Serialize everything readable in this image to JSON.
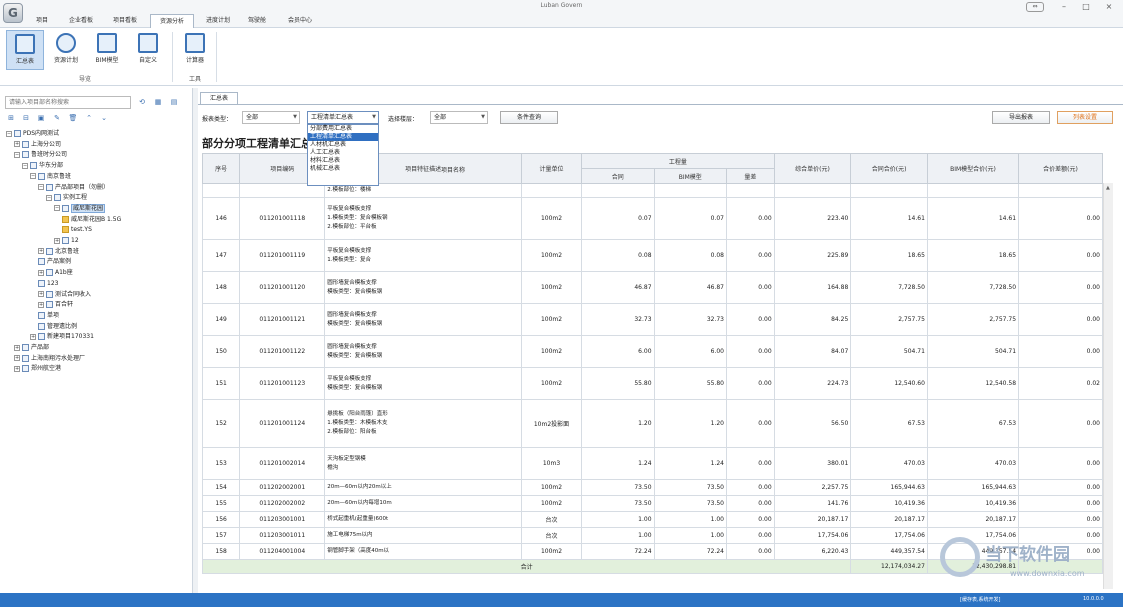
{
  "app": {
    "title": "Luban Govern"
  },
  "window": {
    "link_icon": "link-icon",
    "minimize": "–",
    "maximize": "□",
    "close": "×"
  },
  "menu": {
    "tabs": [
      {
        "label": "项目"
      },
      {
        "label": "企业看板"
      },
      {
        "label": "项目看板"
      },
      {
        "label": "资源分析"
      },
      {
        "label": "进度计划"
      },
      {
        "label": "驾驶舱"
      },
      {
        "label": "会员中心"
      }
    ],
    "active_index": 3
  },
  "ribbon": {
    "buttons": [
      {
        "label": "汇总表",
        "icon": "summary-table-icon"
      },
      {
        "label": "资源计划",
        "icon": "resource-plan-icon"
      },
      {
        "label": "BIM模型",
        "icon": "bim-model-icon"
      },
      {
        "label": "自定义",
        "icon": "custom-icon"
      },
      {
        "label": "计算器",
        "icon": "calculator-icon"
      }
    ],
    "group_nav": "导览",
    "group_tools": "工具"
  },
  "left": {
    "search_placeholder": "请输入项目部名称搜索",
    "tree": [
      {
        "label": "PDS内网测试",
        "level": 0,
        "exp": "−"
      },
      {
        "label": "上海分公司",
        "level": 1,
        "exp": "+"
      },
      {
        "label": "鲁班时分公司",
        "level": 1,
        "exp": "−"
      },
      {
        "label": "华东分部",
        "level": 2,
        "exp": "−"
      },
      {
        "label": "南京鲁班",
        "level": 3,
        "exp": "−"
      },
      {
        "label": "产品部项目（勿删）",
        "level": 4,
        "exp": "−"
      },
      {
        "label": "实例工程",
        "level": 5,
        "exp": "−"
      },
      {
        "label": "威尼斯花园",
        "level": 6,
        "exp": "−",
        "selected": true
      },
      {
        "label": "威尼斯花园B 1.5G",
        "level": 7,
        "folder": true
      },
      {
        "label": "test.YS",
        "level": 7,
        "folder": true
      },
      {
        "label": "12",
        "level": 6,
        "exp": "+"
      },
      {
        "label": "北京鲁班",
        "level": 4,
        "exp": "+"
      },
      {
        "label": "产品案例",
        "level": 4
      },
      {
        "label": "A1b座",
        "level": 4,
        "exp": "+"
      },
      {
        "label": "123",
        "level": 4
      },
      {
        "label": "测试合同收入",
        "level": 4,
        "exp": "+"
      },
      {
        "label": "百合轩",
        "level": 4,
        "exp": "+"
      },
      {
        "label": "单项",
        "level": 4
      },
      {
        "label": "管理遗比例",
        "level": 4
      },
      {
        "label": "新建项目170331",
        "level": 3,
        "exp": "+"
      },
      {
        "label": "产品部",
        "level": 1,
        "exp": "+"
      },
      {
        "label": "上海南翔污水处理厂",
        "level": 1,
        "exp": "+"
      },
      {
        "label": "郑州航空港",
        "level": 1,
        "exp": "+"
      }
    ]
  },
  "right": {
    "tab": "汇总表",
    "report_type_label": "报表类型：",
    "report_type_value": "全部",
    "report_name_value": "工程清单汇总表",
    "floor_label": "选择楼层：",
    "floor_value": "全部",
    "query_button": "条件查询",
    "export_button": "导出报表",
    "column_set_button": "列表设置",
    "dropdown_items": [
      "分部费用汇总表",
      "工程清单汇总表",
      "人材机汇总表",
      "人工汇总表",
      "材料汇总表",
      "机械汇总表"
    ],
    "dropdown_selected": 1,
    "report_title": "部分分项工程清单汇总表"
  },
  "table": {
    "headers": {
      "seq": "序号",
      "code": "项目编码",
      "name": "项目名称",
      "desc": "项目特征描述",
      "unit": "计量单位",
      "qty_group": "工程量",
      "qty_contract": "合同",
      "qty_bim": "BIM模型",
      "qty_diff": "量差",
      "unit_price": "综合单价(元)",
      "contract_total": "合同合价(元)",
      "bim_total": "BIM模型合价(元)",
      "diff_total": "合价差额(元)"
    },
    "rows": [
      {
        "seq": "",
        "code": "",
        "desc": [
          "2.模板部位：楼梯"
        ],
        "unit": "",
        "c": "",
        "b": "",
        "d": "",
        "up": "",
        "ct": "",
        "bt": "",
        "dt": ""
      },
      {
        "seq": "146",
        "code": "011201001118",
        "desc": [
          "平板复合模板支撑",
          "1.模板类型：复合模板钢",
          "2.模板部位：平台板"
        ],
        "unit": "100m2",
        "c": "0.07",
        "b": "0.07",
        "d": "0.00",
        "up": "223.40",
        "ct": "14.61",
        "bt": "14.61",
        "dt": "0.00"
      },
      {
        "seq": "147",
        "code": "011201001119",
        "desc": [
          "平板复合模板支撑",
          "1.模板类型：复合"
        ],
        "unit": "100m2",
        "c": "0.08",
        "b": "0.08",
        "d": "0.00",
        "up": "225.89",
        "ct": "18.65",
        "bt": "18.65",
        "dt": "0.00"
      },
      {
        "seq": "148",
        "code": "011201001120",
        "desc": [
          "圆形墙复合模板支撑",
          "模板类型：复合模板钢"
        ],
        "unit": "100m2",
        "c": "46.87",
        "b": "46.87",
        "d": "0.00",
        "up": "164.88",
        "ct": "7,728.50",
        "bt": "7,728.50",
        "dt": "0.00"
      },
      {
        "seq": "149",
        "code": "011201001121",
        "desc": [
          "圆形墙复合模板支撑",
          "模板类型：复合模板钢"
        ],
        "unit": "100m2",
        "c": "32.73",
        "b": "32.73",
        "d": "0.00",
        "up": "84.25",
        "ct": "2,757.75",
        "bt": "2,757.75",
        "dt": "0.00"
      },
      {
        "seq": "150",
        "code": "011201001122",
        "desc": [
          "圆形墙复合模板支撑",
          "模板类型：复合模板钢"
        ],
        "unit": "100m2",
        "c": "6.00",
        "b": "6.00",
        "d": "0.00",
        "up": "84.07",
        "ct": "504.71",
        "bt": "504.71",
        "dt": "0.00"
      },
      {
        "seq": "151",
        "code": "011201001123",
        "desc": [
          "平板复合模板支撑",
          "模板类型：复合模板钢"
        ],
        "unit": "100m2",
        "c": "55.80",
        "b": "55.80",
        "d": "0.00",
        "up": "224.73",
        "ct": "12,540.60",
        "bt": "12,540.58",
        "dt": "0.02"
      },
      {
        "seq": "152",
        "code": "011201001124",
        "desc": [
          "悬挑板（阳台雨篷）直形",
          "1.模板类型：木模板木支",
          "2.模板部位：阳台板"
        ],
        "unit": "10m2投影面",
        "c": "1.20",
        "b": "1.20",
        "d": "0.00",
        "up": "56.50",
        "ct": "67.53",
        "bt": "67.53",
        "dt": "0.00"
      },
      {
        "seq": "153",
        "code": "011201002014",
        "desc": [
          "天沟板定型钢模",
          "檐沟"
        ],
        "unit": "10m3",
        "c": "1.24",
        "b": "1.24",
        "d": "0.00",
        "up": "380.01",
        "ct": "470.03",
        "bt": "470.03",
        "dt": "0.00"
      },
      {
        "seq": "154",
        "code": "011202002001",
        "desc": [
          "20m—60m以内20m以上"
        ],
        "unit": "100m2",
        "c": "73.50",
        "b": "73.50",
        "d": "0.00",
        "up": "2,257.75",
        "ct": "165,944.63",
        "bt": "165,944.63",
        "dt": "0.00"
      },
      {
        "seq": "155",
        "code": "011202002002",
        "desc": [
          "20m—60m以内每增10m"
        ],
        "unit": "100m2",
        "c": "73.50",
        "b": "73.50",
        "d": "0.00",
        "up": "141.76",
        "ct": "10,419.36",
        "bt": "10,419.36",
        "dt": "0.00"
      },
      {
        "seq": "156",
        "code": "011203001001",
        "desc": [
          "桥式起重机(起重量)600t"
        ],
        "unit": "台次",
        "c": "1.00",
        "b": "1.00",
        "d": "0.00",
        "up": "20,187.17",
        "ct": "20,187.17",
        "bt": "20,187.17",
        "dt": "0.00"
      },
      {
        "seq": "157",
        "code": "011203001011",
        "desc": [
          "施工电梯75m以内"
        ],
        "unit": "台次",
        "c": "1.00",
        "b": "1.00",
        "d": "0.00",
        "up": "17,754.06",
        "ct": "17,754.06",
        "bt": "17,754.06",
        "dt": "0.00"
      },
      {
        "seq": "158",
        "code": "011204001004",
        "desc": [
          "钢管脚手架（高度40m以"
        ],
        "unit": "100m2",
        "c": "72.24",
        "b": "72.24",
        "d": "0.00",
        "up": "6,220.43",
        "ct": "449,357.54",
        "bt": "449,357.54",
        "dt": "0.00"
      }
    ],
    "total_label": "合计",
    "total_contract": "12,174,034.27",
    "total_bim": "12,430,298.81"
  },
  "status": {
    "left": "",
    "right_label": "[缓存表,系统开发]",
    "version": "10.0.0.0"
  },
  "watermark": {
    "text": "当下软件园",
    "url": "www.downxia.com"
  }
}
